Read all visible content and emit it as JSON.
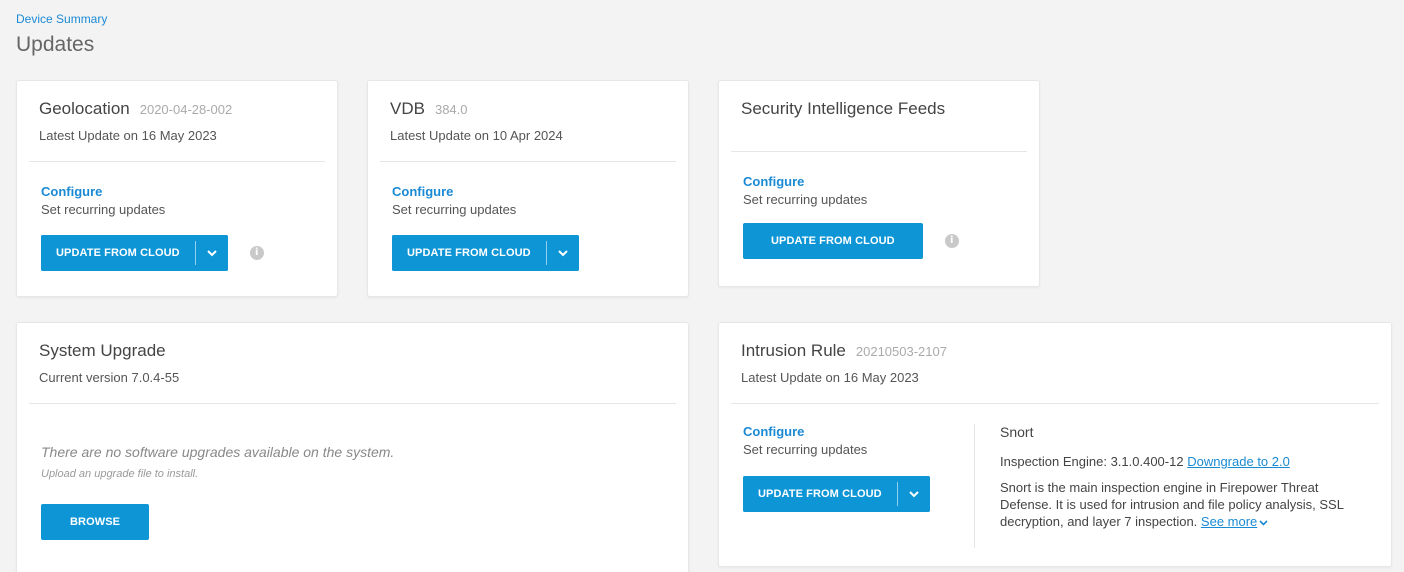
{
  "breadcrumb": "Device Summary",
  "page_title": "Updates",
  "geolocation": {
    "title": "Geolocation",
    "version": "2020-04-28-002",
    "latest": "Latest Update on 16 May 2023",
    "configure": "Configure",
    "recurring": "Set recurring updates",
    "button": "UPDATE FROM CLOUD",
    "info": "i"
  },
  "vdb": {
    "title": "VDB",
    "version": "384.0",
    "latest": "Latest Update on 10 Apr 2024",
    "configure": "Configure",
    "recurring": "Set recurring updates",
    "button": "UPDATE FROM CLOUD"
  },
  "si_feeds": {
    "title": "Security Intelligence Feeds",
    "configure": "Configure",
    "recurring": "Set recurring updates",
    "button": "UPDATE FROM CLOUD",
    "info": "i"
  },
  "system_upgrade": {
    "title": "System Upgrade",
    "current": "Current version 7.0.4-55",
    "no_upgrades": "There are no software upgrades available on the system.",
    "upload_hint": "Upload an upgrade file to install.",
    "browse": "BROWSE"
  },
  "intrusion_rule": {
    "title": "Intrusion Rule",
    "version": "20210503-2107",
    "latest": "Latest Update on 16 May 2023",
    "configure": "Configure",
    "recurring": "Set recurring updates",
    "button": "UPDATE FROM CLOUD",
    "snort": {
      "title": "Snort",
      "engine_label": "Inspection Engine: 3.1.0.400-12",
      "downgrade": "Downgrade to 2.0",
      "description": "Snort is the main inspection engine in Firepower Threat Defense. It is used for intrusion and file policy analysis, SSL decryption, and layer 7 inspection.",
      "see_more": "See more"
    }
  },
  "colors": {
    "accent": "#0d95d6",
    "link": "#1a8ad4",
    "background": "#f3f3f3"
  }
}
